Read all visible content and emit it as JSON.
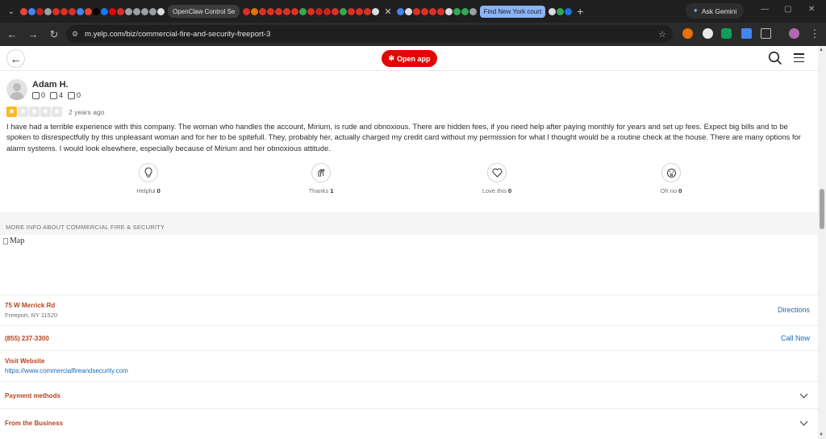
{
  "browser": {
    "tabs": {
      "active_title": "OpenClaw Control Se",
      "group_label": "Find New York court",
      "ask_gemini": "Ask Gemini"
    },
    "url": "m.yelp.com/biz/commercial-fire-and-security-freeport-3"
  },
  "header": {
    "open_app": "Open app"
  },
  "review": {
    "name": "Adam H.",
    "friends": "0",
    "reviews": "4",
    "photos": "0",
    "rating": 1,
    "date": "2 years ago",
    "text": "I have had a terrible experience with this company. The woman who handles the account, Mirium, is rude and obnoxious. There are hidden fees, if you need help after paying monthly for years and set up fees. Expect big bills and to be spoken to disrespectfully by this unpleasant woman and for her to be spitefull. They, probably her, actually charged my credit card without my permission for what I thought would be a routine check at the house. There are many options for alarm systems. I would look elsewhere, especially because of Mirium and her obnoxious attitude."
  },
  "reactions": [
    {
      "label": "Helpful",
      "count": "0"
    },
    {
      "label": "Thanks",
      "count": "1"
    },
    {
      "label": "Love this",
      "count": "0"
    },
    {
      "label": "Oh no",
      "count": "0"
    }
  ],
  "more_info": {
    "heading": "MORE INFO ABOUT COMMERCIAL FIRE & SECURITY",
    "map_alt": "Map",
    "address_line1": "75 W Merrick Rd",
    "address_line2": "Freeport, NY 11520",
    "directions": "Directions",
    "phone": "(855) 237-3300",
    "call_now": "Call Now",
    "website_label": "Visit Website",
    "website_url": "https://www.commercialfireandsecurity.com",
    "payment_methods": "Payment methods",
    "from_business": "From the Business"
  },
  "colors": {
    "yelp_red": "#e00707",
    "star_gold": "#fbb71f",
    "link_blue": "#1a6ab3",
    "info_orange": "#b4451f"
  }
}
